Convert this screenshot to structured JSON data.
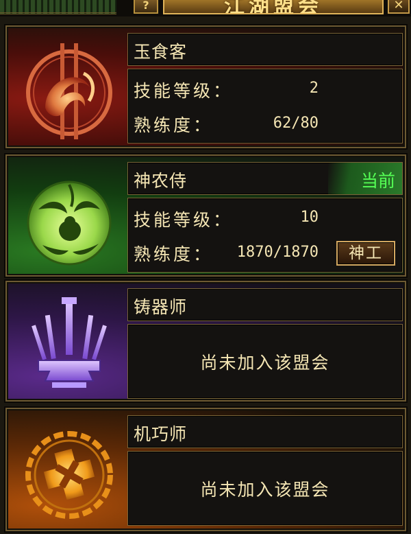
{
  "window": {
    "title": "江湖盟会",
    "help_icon": "help-icon",
    "close_icon": "close-icon"
  },
  "guilds": [
    {
      "name": "玉食客",
      "theme": "#8a1a12",
      "emblem_icon": "fish-emblem-icon",
      "joined": true,
      "skill_level_label": "技能等级：",
      "skill_level": "2",
      "proficiency_label": "熟练度：",
      "proficiency": "62/80"
    },
    {
      "name": "神农侍",
      "theme": "#2a7a22",
      "emblem_icon": "gourd-emblem-icon",
      "joined": true,
      "current_label": "当前",
      "skill_level_label": "技能等级：",
      "skill_level": "10",
      "proficiency_label": "熟练度：",
      "proficiency": "1870/1870",
      "action_label": "神工"
    },
    {
      "name": "铸器师",
      "theme": "#5a2a8a",
      "emblem_icon": "anvil-weapons-emblem-icon",
      "joined": false,
      "status": "尚未加入该盟会"
    },
    {
      "name": "机巧师",
      "theme": "#b0500a",
      "emblem_icon": "gear-emblem-icon",
      "joined": false,
      "status": "尚未加入该盟会"
    }
  ]
}
